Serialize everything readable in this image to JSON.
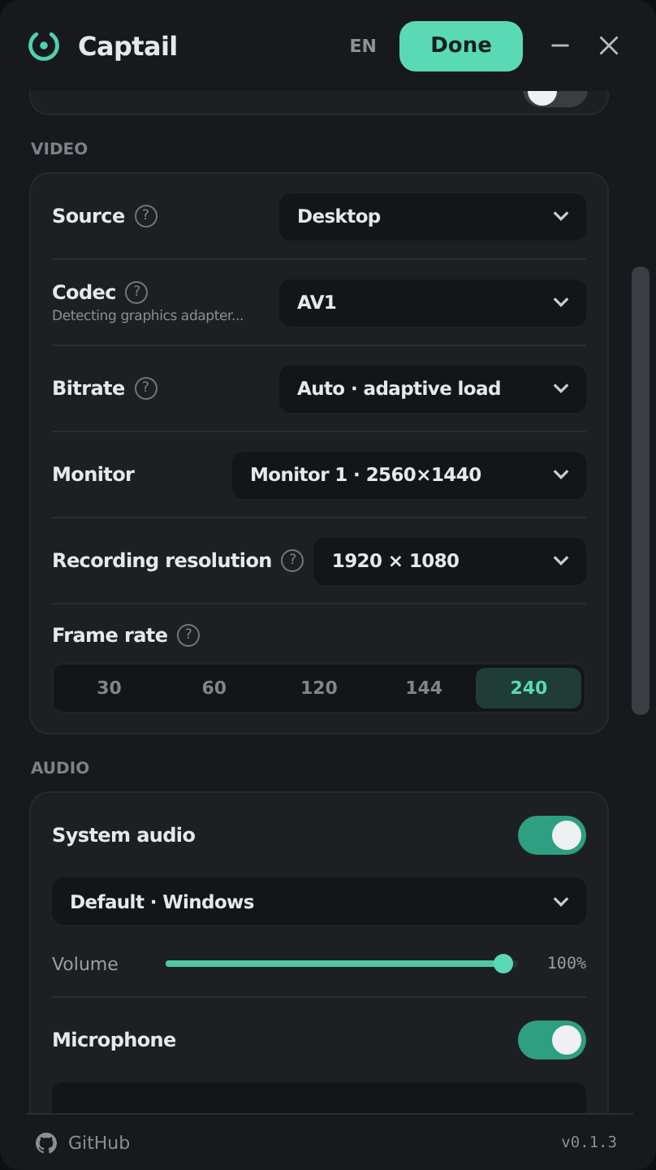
{
  "header": {
    "title": "Captail",
    "language": "EN",
    "done_button": "Done"
  },
  "top_card": {
    "toggle_on": false
  },
  "video": {
    "heading": "VIDEO",
    "rows": [
      {
        "kind": "select",
        "label": "Source",
        "help": "?",
        "value": "Desktop"
      },
      {
        "kind": "select",
        "label": "Codec",
        "help": "?",
        "hint": "Detecting graphics adapter...",
        "value": "AV1"
      },
      {
        "kind": "select",
        "label": "Bitrate",
        "help": "?",
        "value": "Auto · adaptive load"
      },
      {
        "kind": "wide_select",
        "label": "Monitor",
        "value": "Monitor 1 · 2560×1440"
      },
      {
        "kind": "select",
        "label": "Recording resolution",
        "help": "?",
        "value": "1920 × 1080"
      },
      {
        "kind": "segments",
        "label": "Frame rate",
        "help": "?",
        "options": [
          {
            "label": "30",
            "selected": false
          },
          {
            "label": "60",
            "selected": false
          },
          {
            "label": "120",
            "selected": false
          },
          {
            "label": "144",
            "selected": false
          },
          {
            "label": "240",
            "selected": true
          }
        ]
      }
    ]
  },
  "audio": {
    "heading": "AUDIO",
    "system": {
      "label": "System audio",
      "on": true,
      "device": "Default · Windows",
      "volume_label": "Volume",
      "level": 0.96,
      "reading": "100%"
    },
    "microphone": {
      "label": "Microphone",
      "on": true
    }
  },
  "footer": {
    "link": "GitHub",
    "version": "v0.1.3"
  }
}
